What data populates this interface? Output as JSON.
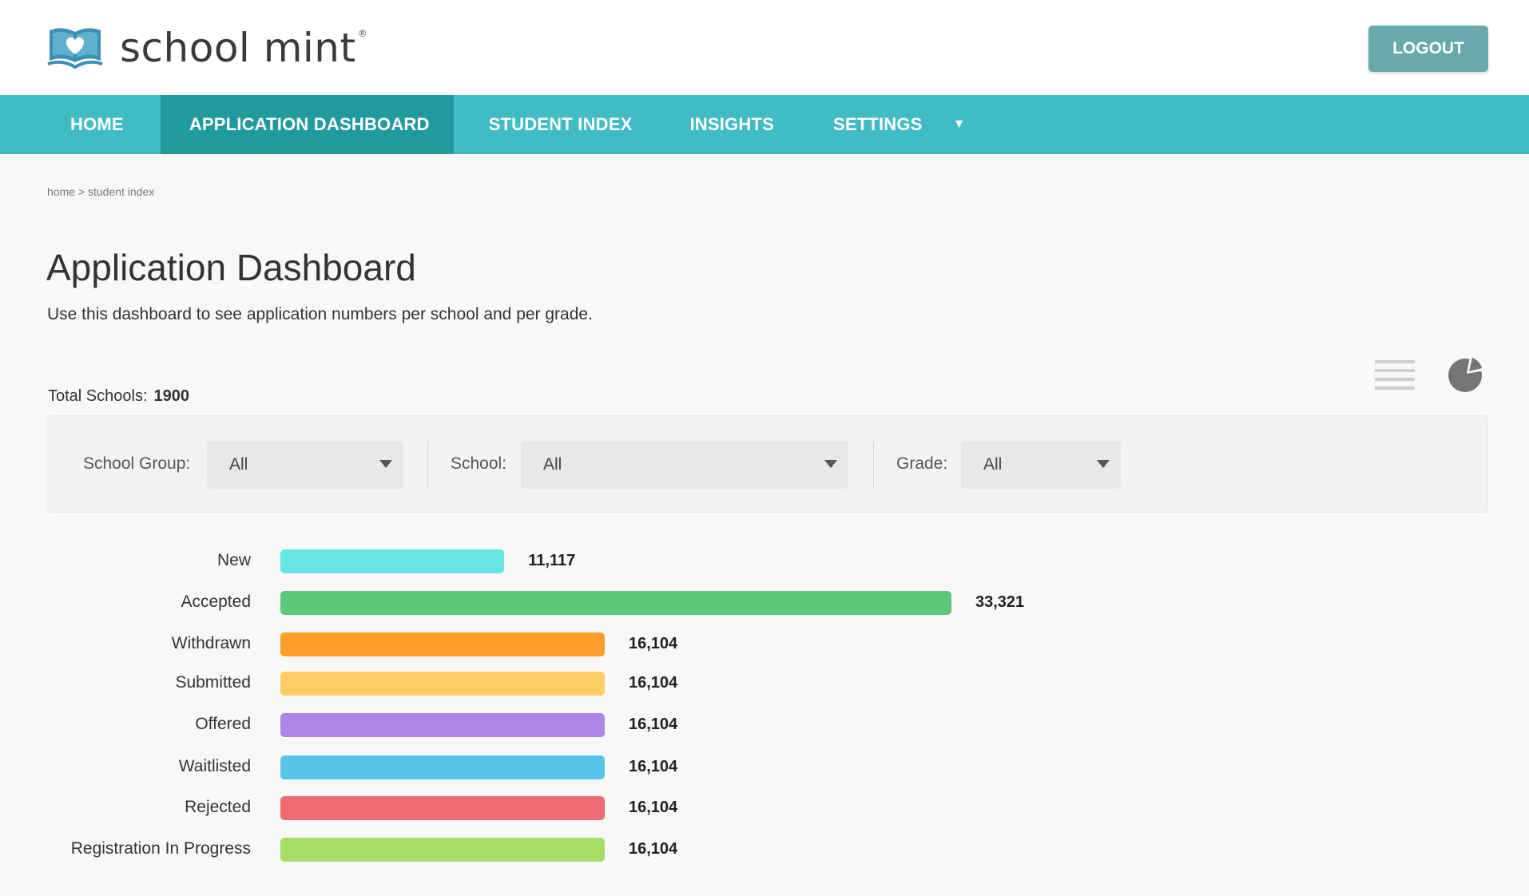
{
  "brand": {
    "name": "school mint",
    "reg_mark": "®"
  },
  "header": {
    "logout_label": "LOGOUT"
  },
  "nav": {
    "items": [
      {
        "label": "HOME",
        "active": false
      },
      {
        "label": "APPLICATION DASHBOARD",
        "active": true
      },
      {
        "label": "STUDENT INDEX",
        "active": false
      },
      {
        "label": "INSIGHTS",
        "active": false
      },
      {
        "label": "SETTINGS",
        "active": false
      }
    ],
    "settings_caret": "▼"
  },
  "breadcrumb": "home > student index",
  "page": {
    "title": "Application Dashboard",
    "subtitle": "Use this dashboard to see application numbers per school and per grade."
  },
  "totals": {
    "label": "Total Schools:",
    "value": "1900"
  },
  "filters": {
    "school_group": {
      "label": "School Group:",
      "value": "All"
    },
    "school": {
      "label": "School:",
      "value": "All"
    },
    "grade": {
      "label": "Grade:",
      "value": "All"
    }
  },
  "view_icons": [
    "list-icon",
    "pie-chart-icon"
  ],
  "colors": {
    "nav": "#41bcc5",
    "nav_active": "#219a9e",
    "logout": "#6aa9ab"
  },
  "chart_data": {
    "type": "bar",
    "orientation": "horizontal",
    "categories": [
      "New",
      "Accepted",
      "Withdrawn",
      "Submitted",
      "Offered",
      "Waitlisted",
      "Rejected",
      "Registration In Progress"
    ],
    "value_labels": [
      "11,117",
      "33,321",
      "16,104",
      "16,104",
      "16,104",
      "16,104",
      "16,104",
      "16,104"
    ],
    "values": [
      11117,
      33321,
      16104,
      16104,
      16104,
      16104,
      16104,
      16104
    ],
    "colors": [
      "#66e5e5",
      "#5ec87a",
      "#ff9c2a",
      "#ffcb63",
      "#b185e6",
      "#55c6ea",
      "#ee6b73",
      "#a6dd69"
    ],
    "legend": "none",
    "grid": false
  }
}
